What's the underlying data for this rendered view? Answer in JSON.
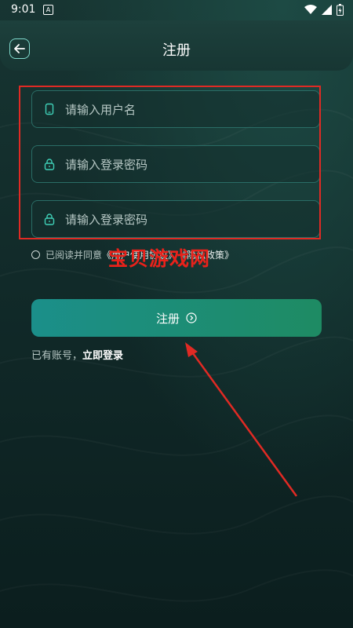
{
  "status_bar": {
    "time": "9:01",
    "app_icon": "A"
  },
  "header": {
    "title": "注册",
    "back_icon": "back-arrow-icon"
  },
  "form": {
    "username_placeholder": "请输入用户名",
    "password_placeholder": "请输入登录密码",
    "confirm_placeholder": "请输入登录密码"
  },
  "agreement": {
    "prefix": "已阅读并同意",
    "user_agreement": "《用户使用协议》",
    "privacy_policy": "《隐私政策》"
  },
  "register_button": {
    "label": "注册"
  },
  "login_prompt": {
    "text": "已有账号，",
    "link": "立即登录"
  },
  "watermark": {
    "text": "宝贝游戏网"
  },
  "colors": {
    "accent": "#7fd9cc",
    "button_start": "#1b8f8a",
    "button_end": "#1e8b63",
    "annotation": "#e02a24"
  }
}
